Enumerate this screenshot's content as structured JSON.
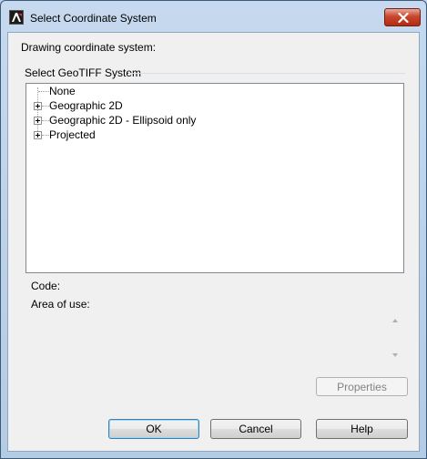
{
  "window": {
    "title": "Select Coordinate System"
  },
  "dialog": {
    "drawing_label": "Drawing coordinate system:",
    "group_title": "Select GeoTIFF System",
    "tree": [
      {
        "label": "None",
        "expandable": false
      },
      {
        "label": "Geographic 2D",
        "expandable": true
      },
      {
        "label": "Geographic 2D - Ellipsoid only",
        "expandable": true
      },
      {
        "label": "Projected",
        "expandable": true
      }
    ],
    "code_label": "Code:",
    "area_label": "Area of use:",
    "properties_label": "Properties"
  },
  "buttons": {
    "ok": "OK",
    "cancel": "Cancel",
    "help": "Help"
  },
  "icons": {
    "app": "autocad-app-icon",
    "close": "close-icon"
  },
  "colors": {
    "close_button": "#c9452c",
    "default_button_border": "#3c7fb1"
  }
}
